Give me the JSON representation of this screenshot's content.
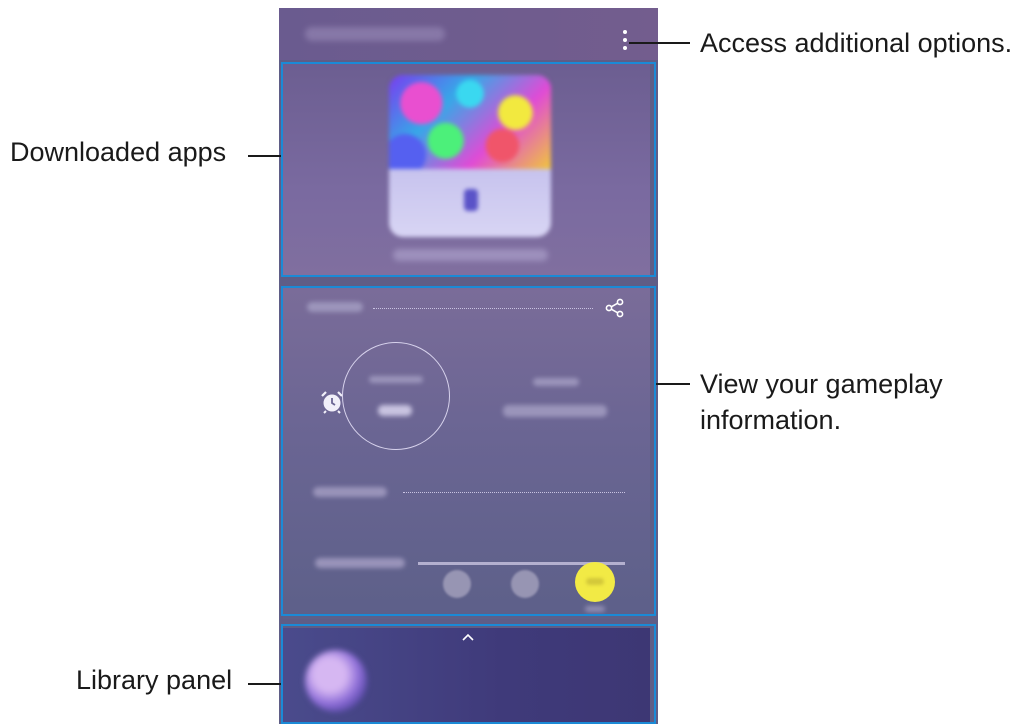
{
  "callouts": {
    "options": "Access additional options.",
    "downloads": "Downloaded apps",
    "gameplay_line1": "View your gameplay",
    "gameplay_line2": "information.",
    "library": "Library panel"
  },
  "icons": {
    "more": "more-options-icon",
    "share": "share-icon",
    "alarm": "alarm-clock-icon",
    "chevron": "chevron-up-icon"
  },
  "colors": {
    "highlight": "#1b8ad6",
    "accent_yellow": "#f2ea45",
    "callout_text": "#1a1a1a"
  }
}
